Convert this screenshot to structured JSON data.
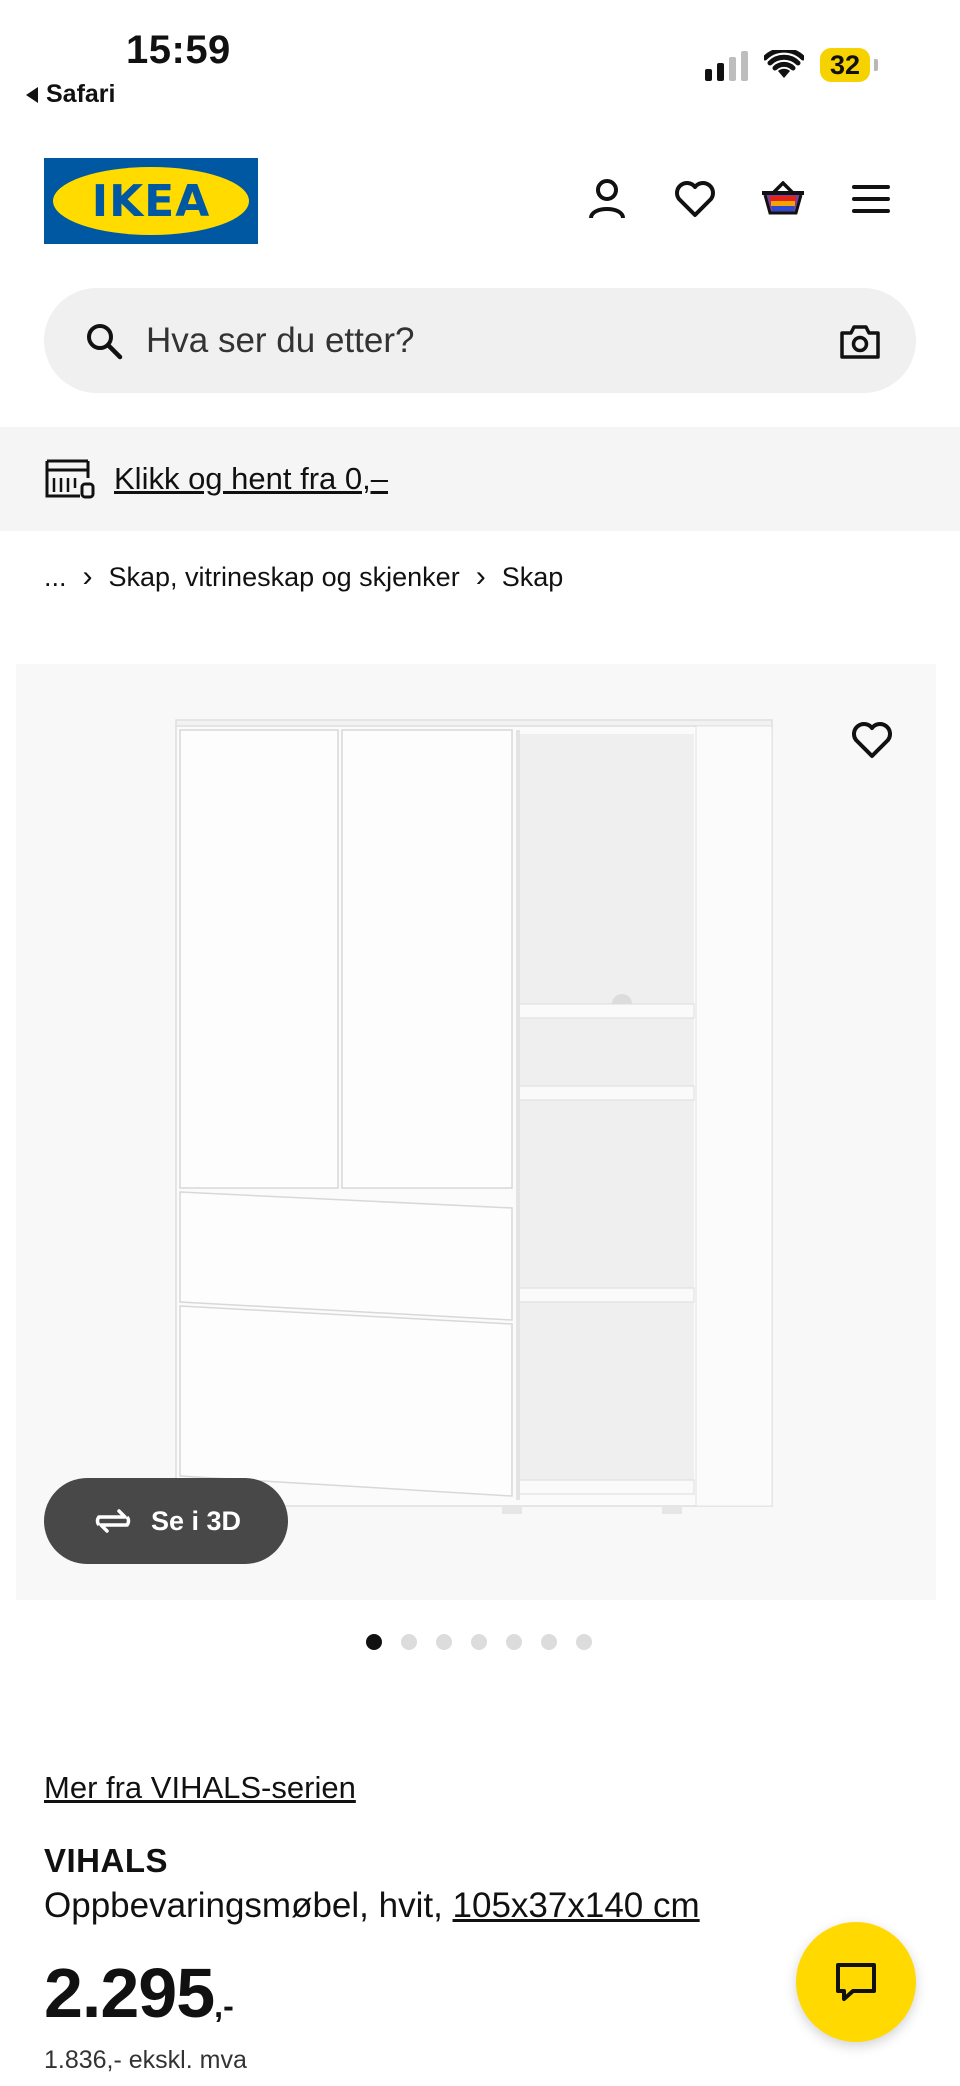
{
  "status_bar": {
    "time": "15:59",
    "back_app": "Safari",
    "battery": "32"
  },
  "header": {
    "logo_text": "IKEA",
    "icons": [
      "account-icon",
      "heart-icon",
      "basket-icon",
      "menu-icon"
    ]
  },
  "search": {
    "placeholder": "Hva ser du etter?"
  },
  "promo": {
    "text": "Klikk og hent fra 0,–"
  },
  "breadcrumb": {
    "items": [
      "...",
      "Skap, vitrineskap og skjenker",
      "Skap"
    ]
  },
  "gallery": {
    "see_3d_label": "Se i 3D",
    "dot_count": 7,
    "active_dot": 0
  },
  "product": {
    "series_link": "Mer fra VIHALS-serien",
    "name": "VIHALS",
    "description": "Oppbevaringsmøbel, hvit,",
    "dimensions": "105x37x140 cm",
    "price": "2.295",
    "price_suffix": ",-",
    "price_ex_vat": "1.836,- ekskl. mva"
  },
  "colors": {
    "ikea_blue": "#0058a3",
    "ikea_yellow": "#ffdb00",
    "chat_yellow": "#ffd900",
    "dark_pill": "#484848"
  }
}
